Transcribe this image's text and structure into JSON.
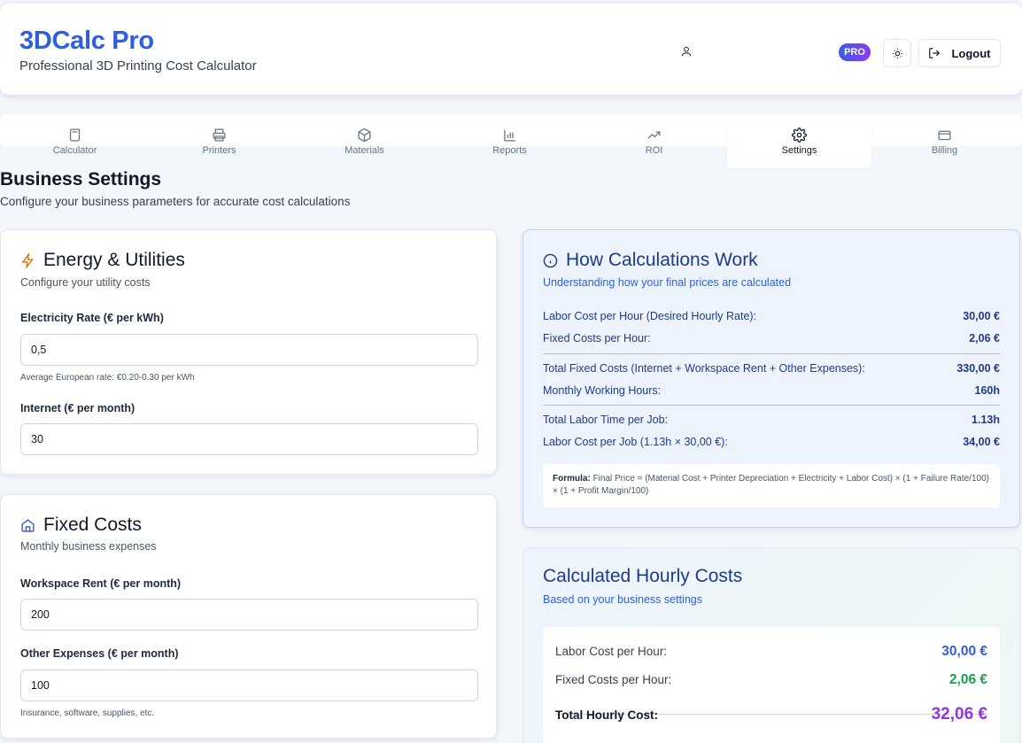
{
  "header": {
    "title": "3DCalc Pro",
    "subtitle": "Professional 3D Printing Cost Calculator",
    "badge": "PRO",
    "logout_label": "Logout"
  },
  "tabs": [
    {
      "label": "Calculator",
      "icon": "calculator-icon"
    },
    {
      "label": "Printers",
      "icon": "printer-icon"
    },
    {
      "label": "Materials",
      "icon": "box-icon"
    },
    {
      "label": "Reports",
      "icon": "bar-chart-icon"
    },
    {
      "label": "ROI",
      "icon": "trending-up-icon"
    },
    {
      "label": "Settings",
      "icon": "gear-icon",
      "active": true
    },
    {
      "label": "Billing",
      "icon": "credit-card-icon"
    }
  ],
  "page": {
    "title": "Business Settings",
    "subtitle": "Configure your business parameters for accurate cost calculations"
  },
  "energy": {
    "title": "Energy & Utilities",
    "desc": "Configure your utility costs",
    "electricity_label": "Electricity Rate (€ per kWh)",
    "electricity_value": "0,5",
    "electricity_hint": "Average European rate: €0.20-0.30 per kWh",
    "internet_label": "Internet (€ per month)",
    "internet_value": "30"
  },
  "fixed": {
    "title": "Fixed Costs",
    "desc": "Monthly business expenses",
    "rent_label": "Workspace Rent (€ per month)",
    "rent_value": "200",
    "other_label": "Other Expenses (€ per month)",
    "other_value": "100",
    "other_hint": "Insurance, software, supplies, etc."
  },
  "how": {
    "title": "How Calculations Work",
    "subtitle": "Understanding how your final prices are calculated",
    "rows": [
      {
        "label": "Labor Cost per Hour (Desired Hourly Rate):",
        "value": "30,00 €"
      },
      {
        "label": "Fixed Costs per Hour:",
        "value": "2,06 €"
      },
      {
        "label": "Total Fixed Costs (Internet + Workspace Rent + Other Expenses):",
        "value": "330,00 €"
      },
      {
        "label": "Monthly Working Hours:",
        "value": "160h"
      },
      {
        "label": "Total Labor Time per Job:",
        "value": "1.13h"
      },
      {
        "label": "Labor Cost per Job (1.13h × 30,00 €):",
        "value": "34,00 €"
      }
    ],
    "formula_label": "Formula:",
    "formula_text": "Final Price = (Material Cost + Printer Depreciation + Electricity + Labor Cost) × (1 + Failure Rate/100) × (1 + Profit Margin/100)"
  },
  "hourly": {
    "title": "Calculated Hourly Costs",
    "subtitle": "Based on your business settings",
    "labor_label": "Labor Cost per Hour:",
    "labor_value": "30,00 €",
    "fixed_label": "Fixed Costs per Hour:",
    "fixed_value": "2,06 €",
    "total_label": "Total Hourly Cost:",
    "total_value": "32,06 €"
  },
  "colors": {
    "brand": "#2f5fe0",
    "labor_value": "#2f5fe0",
    "fixed_value": "#16a34a",
    "total_value": "#9333ea",
    "energy_icon": "#d97706",
    "fixed_icon": "#2f5fe0"
  }
}
